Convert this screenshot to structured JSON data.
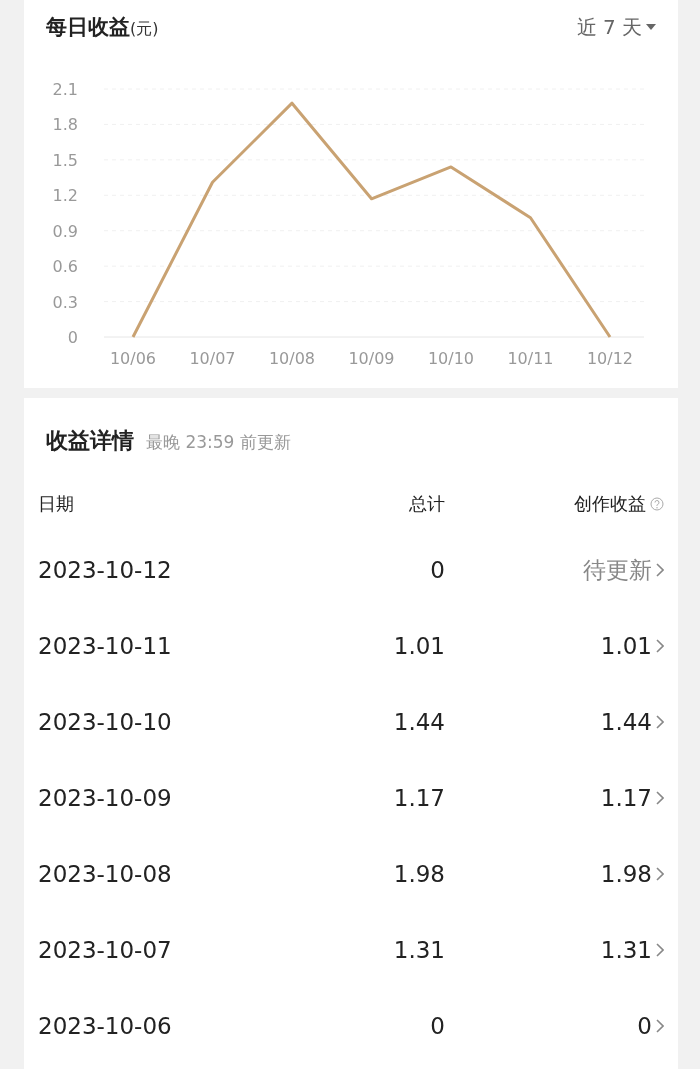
{
  "earnings_card": {
    "title": "每日收益",
    "unit": "(元)",
    "range_selector": "近 7 天",
    "chart_data": {
      "type": "line",
      "categories": [
        "10/06",
        "10/07",
        "10/08",
        "10/09",
        "10/10",
        "10/11",
        "10/12"
      ],
      "grid": true,
      "series": [
        {
          "color": "#c9a272",
          "values": [
            0,
            1.31,
            1.98,
            1.17,
            1.44,
            1.01,
            0
          ]
        }
      ],
      "ylim": [
        0,
        2.1
      ],
      "yticks": [
        0,
        0.3,
        0.6,
        0.9,
        1.2,
        1.5,
        1.8,
        2.1
      ]
    }
  },
  "details": {
    "title": "收益详情",
    "subtitle": "最晚 23:59 前更新",
    "columns": [
      "日期",
      "总计",
      "创作收益"
    ],
    "rows": [
      {
        "date": "2023-10-12",
        "total": "0",
        "creation": "待更新",
        "pending": true
      },
      {
        "date": "2023-10-11",
        "total": "1.01",
        "creation": "1.01",
        "pending": false
      },
      {
        "date": "2023-10-10",
        "total": "1.44",
        "creation": "1.44",
        "pending": false
      },
      {
        "date": "2023-10-09",
        "total": "1.17",
        "creation": "1.17",
        "pending": false
      },
      {
        "date": "2023-10-08",
        "total": "1.98",
        "creation": "1.98",
        "pending": false
      },
      {
        "date": "2023-10-07",
        "total": "1.31",
        "creation": "1.31",
        "pending": false
      },
      {
        "date": "2023-10-06",
        "total": "0",
        "creation": "0",
        "pending": false
      }
    ]
  }
}
